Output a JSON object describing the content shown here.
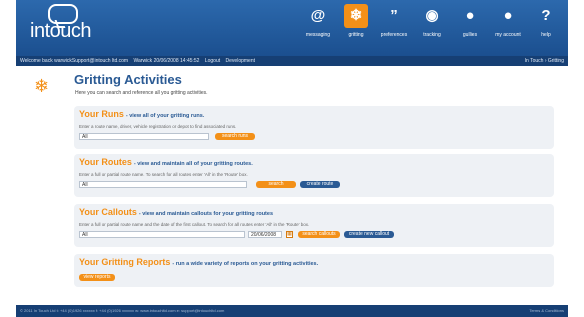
{
  "app": {
    "logo": "intouch"
  },
  "nav": [
    {
      "icon": "at-icon",
      "glyph": "@",
      "label": "messaging",
      "active": false
    },
    {
      "icon": "snowflake-icon",
      "glyph": "❄",
      "label": "gritting",
      "active": true
    },
    {
      "icon": "quote-icon",
      "glyph": "”",
      "label": "preferences",
      "active": false
    },
    {
      "icon": "eye-icon",
      "glyph": "◉",
      "label": "tracking",
      "active": false
    },
    {
      "icon": "drop-icon",
      "glyph": "●",
      "label": "gullies",
      "active": false
    },
    {
      "icon": "user-icon",
      "glyph": "●",
      "label": "my account",
      "active": false
    },
    {
      "icon": "help-icon",
      "glyph": "?",
      "label": "help",
      "active": false
    }
  ],
  "statusbar": {
    "welcome": "Welcome back warwickSupport@intouch ltd.com",
    "org_time": "Warwick 20/06/2008 14:45:52",
    "logout": "Logout",
    "development": "Development",
    "breadcrumb": "In Touch › Gritting"
  },
  "page": {
    "title": "Gritting Activities",
    "subtitle": "Here you can search and reference all you gritting activities."
  },
  "runs": {
    "title": "Your Runs",
    "desc": "- view all of your gritting runs.",
    "help": "Enter a route name, driver, vehicle registration or depot to find associated runs.",
    "value": "All",
    "search": "search runs"
  },
  "routes": {
    "title": "Your Routes",
    "desc": "- view and maintain all of your gritting routes.",
    "help": "Enter a full or partial route name. To search for all routes enter 'All' in the 'Route' box.",
    "value": "All",
    "search": "search",
    "create": "create route"
  },
  "callouts": {
    "title": "Your Callouts",
    "desc": "- view and maintain callouts for your gritting routes",
    "help": "Enter a full or partial route name and the date of the first callout. To search for all routes enter 'All' in the 'Route' box.",
    "value": "All",
    "date": "20/06/2008",
    "search": "search callouts",
    "create": "create new callout"
  },
  "reports": {
    "title": "Your Gritting Reports",
    "desc": "- run a wide variety of reports on your gritting activities.",
    "view": "view reports"
  },
  "footer": {
    "left": "© 2011 In Touch Ltd   t: +44 (0)1926 xxxxxx   f: +44 (0)1926 xxxxxx   w: www.intouchltd.com   e: support@intouchltd.com",
    "right": "Terms & Conditions"
  }
}
